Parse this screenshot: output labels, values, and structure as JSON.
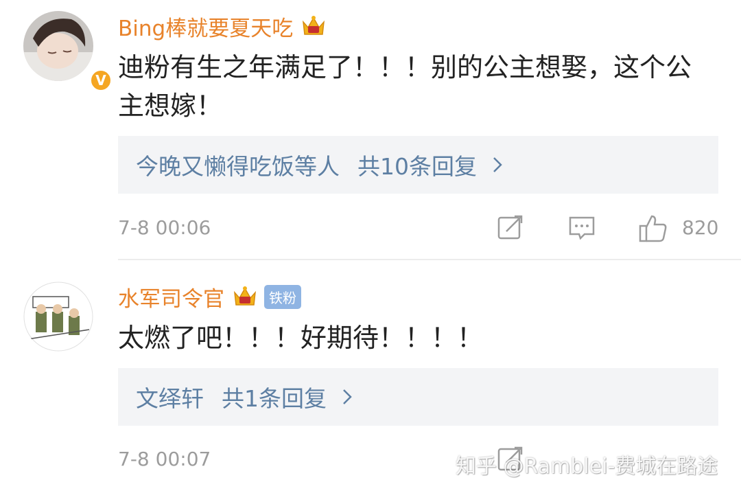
{
  "comments": [
    {
      "username": "Bing棒就要夏天吃",
      "verified_badge": "V",
      "text": "迪粉有生之年满足了！！！别的公主想娶，这个公主想嫁！",
      "reply_preview": {
        "name": "今晚又懒得吃饭等人",
        "count_label": "共10条回复"
      },
      "timestamp": "7-8 00:06",
      "likes": "820"
    },
    {
      "username": "水军司令官",
      "fan_badge": "铁粉",
      "text": "太燃了吧！！！好期待！！！！",
      "reply_preview": {
        "name": "文绎轩",
        "count_label": "共1条回复"
      },
      "timestamp": "7-8 00:07"
    }
  ],
  "watermark": "知乎 @Ramblei-费城在路途",
  "colors": {
    "username": "#e8832b",
    "reply_link": "#5d7fa3",
    "reply_bg": "#f3f4f6",
    "meta": "#9c9c9c",
    "crown": "#f2b21a",
    "fan_badge": "#8fb4e3"
  },
  "icons": [
    "crown-icon",
    "chevron-right-icon",
    "repost-icon",
    "comment-icon",
    "like-icon"
  ]
}
